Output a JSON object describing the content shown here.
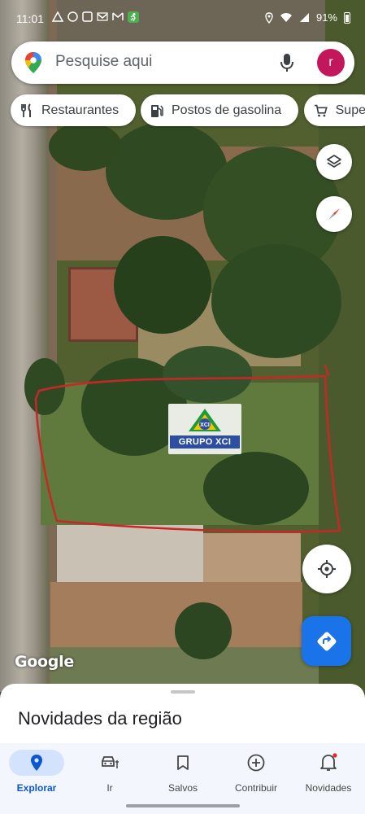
{
  "status_bar": {
    "time": "11:01",
    "battery": "91%"
  },
  "search": {
    "placeholder": "Pesquise aqui",
    "avatar_initial": "r",
    "avatar_color": "#c2185b"
  },
  "chips": [
    {
      "label": "Restaurantes",
      "icon": "fork-knife-icon"
    },
    {
      "label": "Postos de gasolina",
      "icon": "gas-station-icon"
    },
    {
      "label": "Supe",
      "icon": "cart-icon"
    }
  ],
  "map": {
    "overlay_logo_text": "GRUPO XCI",
    "overlay_logo_small": "XCI",
    "attribution": "Google",
    "lot_outline_color": "#c62828"
  },
  "sheet": {
    "title": "Novidades da região"
  },
  "nav": [
    {
      "label": "Explorar",
      "icon": "explore-pin-icon",
      "active": true
    },
    {
      "label": "Ir",
      "icon": "car-icon",
      "active": false
    },
    {
      "label": "Salvos",
      "icon": "bookmark-icon",
      "active": false
    },
    {
      "label": "Contribuir",
      "icon": "add-circle-icon",
      "active": false
    },
    {
      "label": "Novidades",
      "icon": "bell-icon",
      "active": false
    }
  ],
  "colors": {
    "accent": "#1a73e8",
    "nav_active": "#0b57d0",
    "nav_active_bg": "#d3e3fd"
  }
}
